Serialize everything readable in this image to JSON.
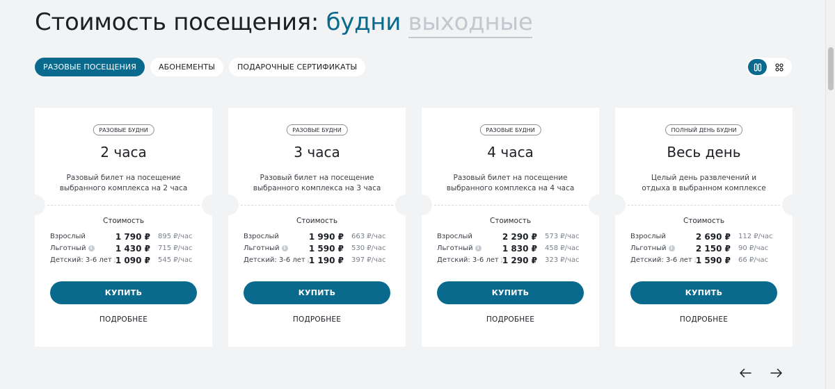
{
  "header": {
    "title_prefix": "Стоимость посещения:",
    "option_active": "будни",
    "option_inactive": "выходные"
  },
  "tabs": [
    {
      "label": "РАЗОВЫЕ ПОСЕЩЕНИЯ",
      "active": true
    },
    {
      "label": "АБОНЕМЕНТЫ",
      "active": false
    },
    {
      "label": "ПОДАРОЧНЫЕ СЕРТИФИКАТЫ",
      "active": false
    }
  ],
  "view_toggle": {
    "options": [
      {
        "icon": "columns-view-icon",
        "active": true
      },
      {
        "icon": "grid-view-icon",
        "active": false
      }
    ]
  },
  "cards": [
    {
      "badge": "РАЗОВЫЕ БУДНИ",
      "title": "2 часа",
      "description": "Разовый билет на посещение выбранного комплекса на 2 часа",
      "cost_label": "Стоимость",
      "prices": [
        {
          "label": "Взрослый",
          "info": false,
          "amount": "1 790 ₽",
          "per_hour": "895 ₽/час"
        },
        {
          "label": "Льготный",
          "info": true,
          "amount": "1 430 ₽",
          "per_hour": "715 ₽/час"
        },
        {
          "label": "Детский: 3-6 лет",
          "info": true,
          "amount": "1 090 ₽",
          "per_hour": "545 ₽/час"
        }
      ],
      "buy_label": "КУПИТЬ",
      "more_label": "ПОДРОБНЕЕ"
    },
    {
      "badge": "РАЗОВЫЕ БУДНИ",
      "title": "3 часа",
      "description": "Разовый билет на посещение выбранного комплекса на 3 часа",
      "cost_label": "Стоимость",
      "prices": [
        {
          "label": "Взрослый",
          "info": false,
          "amount": "1 990 ₽",
          "per_hour": "663 ₽/час"
        },
        {
          "label": "Льготный",
          "info": true,
          "amount": "1 590 ₽",
          "per_hour": "530 ₽/час"
        },
        {
          "label": "Детский: 3-6 лет",
          "info": true,
          "amount": "1 190 ₽",
          "per_hour": "397 ₽/час"
        }
      ],
      "buy_label": "КУПИТЬ",
      "more_label": "ПОДРОБНЕЕ"
    },
    {
      "badge": "РАЗОВЫЕ БУДНИ",
      "title": "4 часа",
      "description": "Разовый билет на посещение выбранного комплекса на 4 часа",
      "cost_label": "Стоимость",
      "prices": [
        {
          "label": "Взрослый",
          "info": false,
          "amount": "2 290 ₽",
          "per_hour": "573 ₽/час"
        },
        {
          "label": "Льготный",
          "info": true,
          "amount": "1 830 ₽",
          "per_hour": "458 ₽/час"
        },
        {
          "label": "Детский: 3-6 лет",
          "info": true,
          "amount": "1 290 ₽",
          "per_hour": "323 ₽/час"
        }
      ],
      "buy_label": "КУПИТЬ",
      "more_label": "ПОДРОБНЕЕ"
    },
    {
      "badge": "ПОЛНЫЙ ДЕНЬ БУДНИ",
      "title": "Весь день",
      "description": "Целый день развлечений и отдыха в выбранном комплексе",
      "cost_label": "Стоимость",
      "prices": [
        {
          "label": "Взрослый",
          "info": false,
          "amount": "2 690 ₽",
          "per_hour": "112 ₽/час"
        },
        {
          "label": "Льготный",
          "info": true,
          "amount": "2 150 ₽",
          "per_hour": "90 ₽/час"
        },
        {
          "label": "Детский: 3-6 лет",
          "info": true,
          "amount": "1 590 ₽",
          "per_hour": "66 ₽/час"
        }
      ],
      "buy_label": "КУПИТЬ",
      "more_label": "ПОДРОБНЕЕ"
    }
  ],
  "navigation": {
    "prev_icon": "arrow-left-icon",
    "next_icon": "arrow-right-icon"
  },
  "colors": {
    "accent": "#0a6a8d",
    "background": "#f2f3f5",
    "muted": "#c3c8cf"
  }
}
